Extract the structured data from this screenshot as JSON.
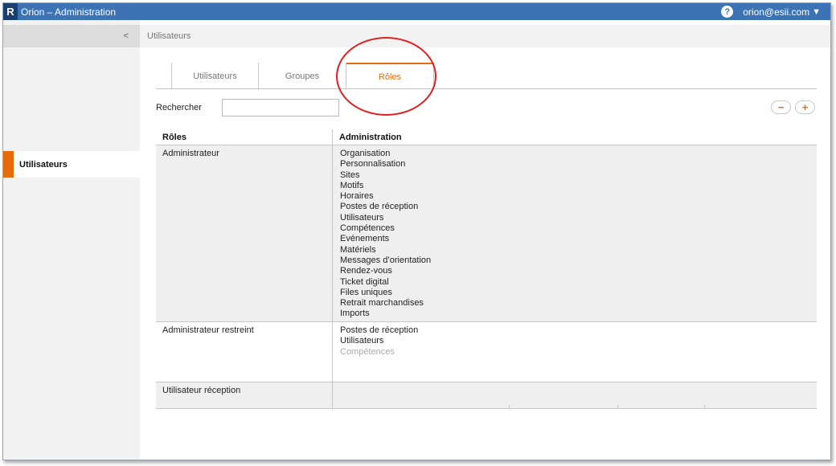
{
  "window": {
    "title": "Orion – Administration",
    "logo_letter": "R",
    "user_email": "orion@esii.com"
  },
  "sidebar": {
    "collapse_label": "<",
    "items": [
      {
        "label": "Utilisateurs",
        "active": true
      }
    ]
  },
  "breadcrumb": "Utilisateurs",
  "tabs": [
    {
      "label": "Utilisateurs",
      "active": false
    },
    {
      "label": "Groupes",
      "active": false
    },
    {
      "label": "Rôles",
      "active": true
    }
  ],
  "search": {
    "label": "Rechercher",
    "value": "",
    "placeholder": ""
  },
  "buttons": {
    "remove": "−",
    "add": "+"
  },
  "table": {
    "headers": [
      "Rôles",
      "Administration"
    ],
    "rows": [
      {
        "role": "Administrateur",
        "permissions": [
          "Organisation",
          "Personnalisation",
          "Sites",
          "Motifs",
          "Horaires",
          "Postes de réception",
          "Utilisateurs",
          "Compétences",
          "Evénements",
          "Matériels",
          "Messages d’orientation",
          "Rendez-vous",
          "Ticket digital",
          "Files uniques",
          "Retrait marchandises",
          "Imports"
        ]
      },
      {
        "role": "Administrateur restreint",
        "permissions": [
          "Postes de réception",
          "Utilisateurs"
        ],
        "muted_permissions": [
          "Compétences"
        ]
      },
      {
        "role": "Utilisateur réception",
        "permissions": []
      }
    ]
  },
  "colors": {
    "titlebar": "#3c73b4",
    "accent": "#e46c0a",
    "annotation": "#e02020"
  }
}
